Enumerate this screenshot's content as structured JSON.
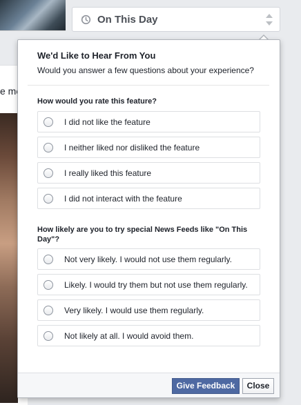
{
  "background": {
    "card_text": "e me"
  },
  "selector": {
    "icon": "clock-icon",
    "title": "On This Day",
    "toggle_icon": "updown-icon"
  },
  "survey": {
    "title": "We'd Like to Hear From You",
    "subtitle": "Would you answer a few questions about your experience?",
    "questions": [
      {
        "text": "How would you rate this feature?",
        "options": [
          "I did not like the feature",
          "I neither liked nor disliked the feature",
          "I really liked this feature",
          "I did not interact with the feature"
        ]
      },
      {
        "text": "How likely are you to try special News Feeds like \"On This Day\"?",
        "options": [
          "Not very likely. I would not use them regularly.",
          "Likely. I would try them but not use them regularly.",
          "Very likely. I would use them regularly.",
          "Not likely at all. I would avoid them."
        ]
      }
    ],
    "buttons": {
      "submit": "Give Feedback",
      "close": "Close"
    }
  },
  "colors": {
    "primary_button": "#4e69a2",
    "page_background": "#e9ebee"
  }
}
